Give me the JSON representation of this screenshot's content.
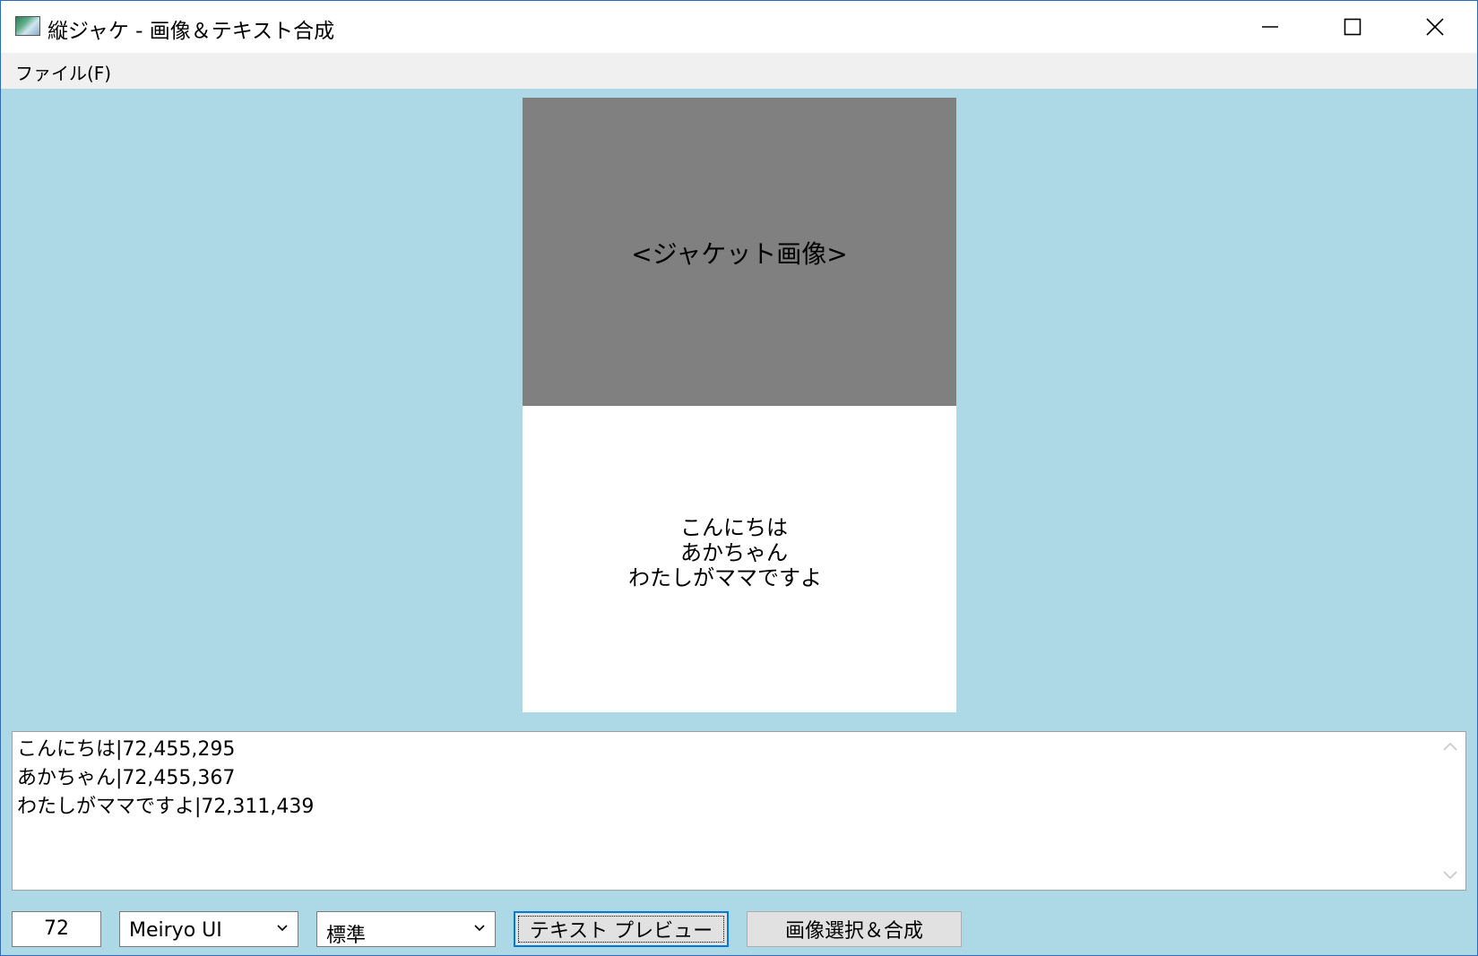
{
  "window": {
    "title": "縦ジャケ - 画像＆テキスト合成",
    "controls": {
      "minimize": "minimize-icon",
      "maximize": "maximize-icon",
      "close": "close-icon"
    }
  },
  "menu": {
    "file": "ファイル(F)"
  },
  "preview": {
    "jacket_label": "<ジャケット画像>",
    "lines": [
      "こんにちは",
      "あかちゃん",
      "わたしがママですよ"
    ]
  },
  "editor": {
    "lines": [
      "こんにちは|72,455,295",
      "あかちゃん|72,455,367",
      "わたしがママですよ|72,311,439"
    ]
  },
  "toolbar": {
    "font_size": "72",
    "font_family": "Meiryo UI",
    "font_style": "標準",
    "preview_button": "テキスト プレビュー",
    "compose_button": "画像選択＆合成"
  },
  "colors": {
    "background": "#add8e6",
    "jacket": "#808080",
    "accent": "#0078d7"
  }
}
